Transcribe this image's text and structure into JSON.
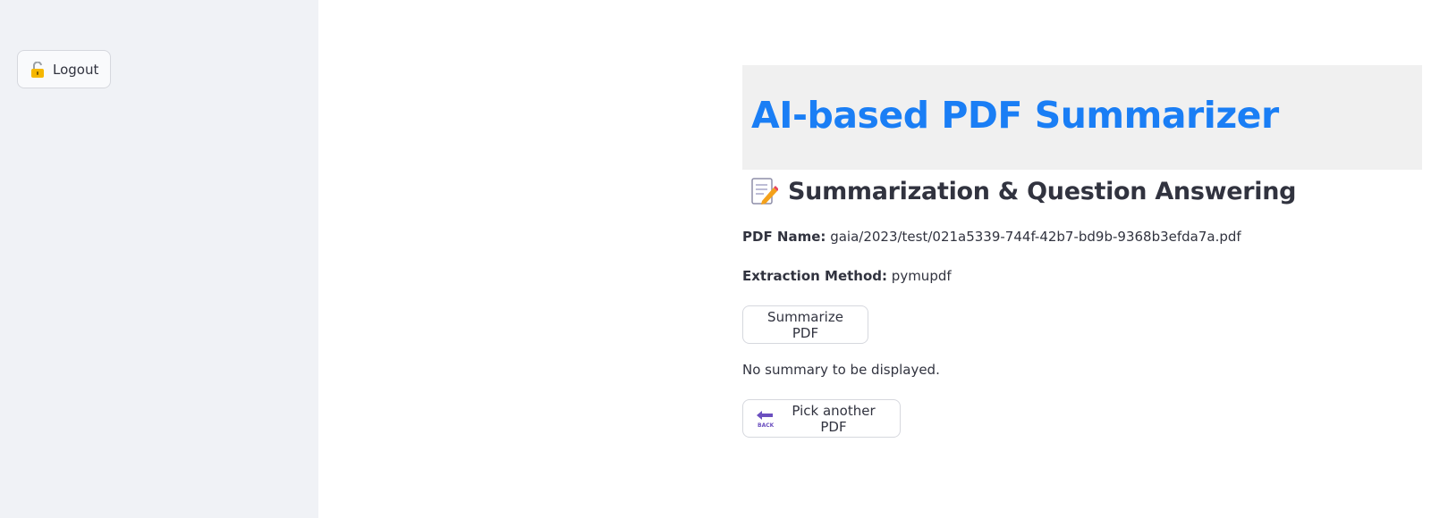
{
  "sidebar": {
    "logout_label": "Logout",
    "logout_icon": "unlocked-padlock-icon"
  },
  "header": {
    "title": "AI-based PDF Summarizer",
    "title_color": "#1a7ef5",
    "band_color": "#f0f0f0"
  },
  "section": {
    "icon": "memo-icon",
    "title": "Summarization & Question Answering"
  },
  "details": {
    "pdf_name_label": "PDF Name:",
    "pdf_name_value": "gaia/2023/test/021a5339-744f-42b7-bd9b-9368b3efda7a.pdf",
    "extraction_label": "Extraction Method:",
    "extraction_value": "pymupdf"
  },
  "actions": {
    "summarize_label": "Summarize PDF",
    "no_summary_text": "No summary to be displayed.",
    "pick_another_label": "Pick another PDF",
    "pick_another_icon": "back-arrow-icon"
  }
}
